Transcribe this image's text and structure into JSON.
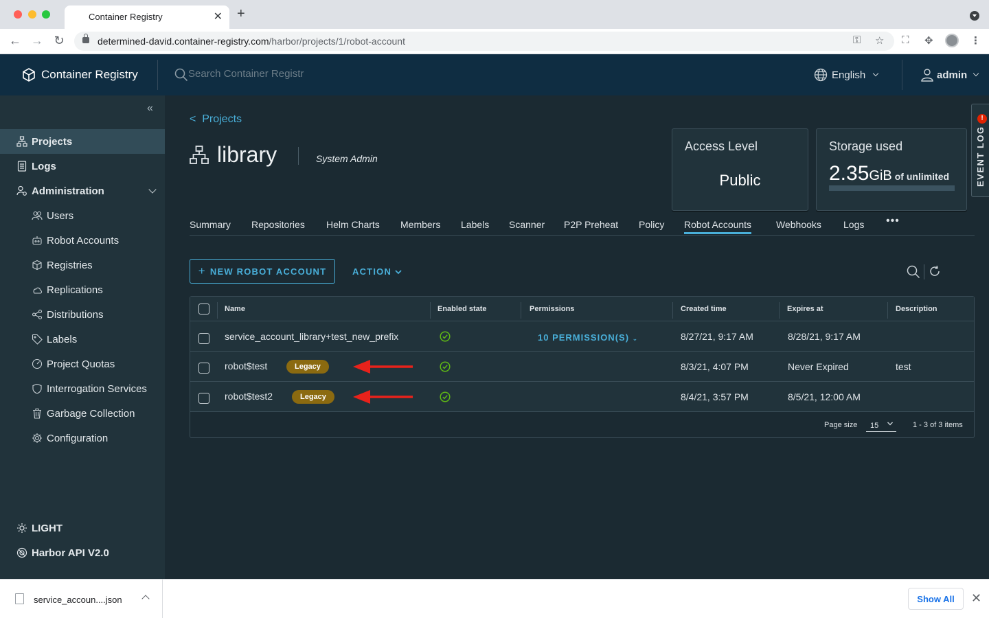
{
  "browser": {
    "tab_title": "Container Registry",
    "url_host": "determined-david.container-registry.com",
    "url_path": "/harbor/projects/1/robot-account"
  },
  "header": {
    "brand": "Container Registry",
    "search_placeholder": "Search Container Registr",
    "language": "English",
    "user": "admin"
  },
  "sidebar": {
    "items": [
      {
        "label": "Projects"
      },
      {
        "label": "Logs"
      },
      {
        "label": "Administration"
      },
      {
        "label": "Users"
      },
      {
        "label": "Robot Accounts"
      },
      {
        "label": "Registries"
      },
      {
        "label": "Replications"
      },
      {
        "label": "Distributions"
      },
      {
        "label": "Labels"
      },
      {
        "label": "Project Quotas"
      },
      {
        "label": "Interrogation Services"
      },
      {
        "label": "Garbage Collection"
      },
      {
        "label": "Configuration"
      }
    ],
    "theme_label": "LIGHT",
    "api_label": "Harbor API V2.0"
  },
  "project": {
    "back_label": "Projects",
    "name": "library",
    "role": "System Admin",
    "access_title": "Access Level",
    "access_value": "Public",
    "storage_title": "Storage used",
    "storage_amount": "2.35",
    "storage_unit": "GiB",
    "storage_limit": "of unlimited",
    "event_log_label": "EVENT LOG",
    "event_log_count": "!"
  },
  "tabs": [
    "Summary",
    "Repositories",
    "Helm Charts",
    "Members",
    "Labels",
    "Scanner",
    "P2P Preheat",
    "Policy",
    "Robot Accounts",
    "Webhooks",
    "Logs"
  ],
  "active_tab": "Robot Accounts",
  "actions": {
    "new_robot": "NEW ROBOT ACCOUNT",
    "action": "ACTION"
  },
  "grid": {
    "columns": [
      "Name",
      "Enabled state",
      "Permissions",
      "Created time",
      "Expires at",
      "Description"
    ],
    "rows": [
      {
        "name": "service_account_library+test_new_prefix",
        "badge": "",
        "permissions": "10 PERMISSION(S)",
        "created": "8/27/21, 9:17 AM",
        "expires": "8/28/21, 9:17 AM",
        "description": ""
      },
      {
        "name": "robot$test",
        "badge": "Legacy",
        "permissions": "",
        "created": "8/3/21, 4:07 PM",
        "expires": "Never Expired",
        "description": "test"
      },
      {
        "name": "robot$test2",
        "badge": "Legacy",
        "permissions": "",
        "created": "8/4/21, 3:57 PM",
        "expires": "8/5/21, 12:00 AM",
        "description": ""
      }
    ],
    "page_size_label": "Page size",
    "page_size": "15",
    "summary": "1 - 3 of 3 items"
  },
  "downloads": {
    "file_name": "service_accoun....json",
    "show_all": "Show All"
  },
  "colors": {
    "accent": "#49afd9",
    "header_bg": "#0f2d42",
    "sidebar_bg": "#21333b",
    "legacy_badge": "#8b6a10",
    "success": "#5eb715",
    "annotation_arrow": "#e8221b"
  }
}
